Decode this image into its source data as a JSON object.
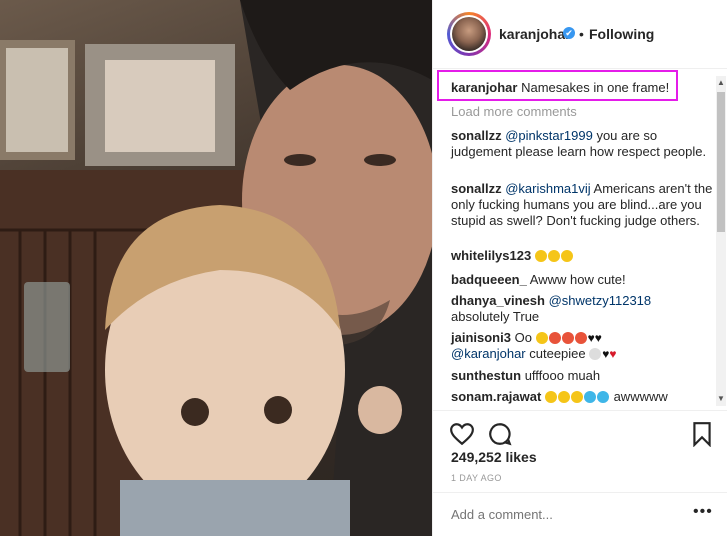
{
  "header": {
    "username": "karanjohar",
    "verified_symbol": "✔",
    "separator": "•",
    "follow_state": "Following"
  },
  "caption": {
    "username": "karanjohar",
    "text": "Namesakes in one frame!"
  },
  "load_more": "Load more comments",
  "comments": [
    {
      "user": "sonallzz",
      "mention": "@pinkstar1999",
      "text": " you are so judgement please learn how respect people."
    },
    {
      "user": "sonallzz",
      "mention": "@karishma1vij",
      "text": " Americans aren't the only fucking humans you are blind...are you stupid as swell? Don't fucking judge others."
    },
    {
      "user": "whitelilys123",
      "mention": "",
      "text": ""
    },
    {
      "user": "badqueeen_",
      "mention": "",
      "text": "Awww how cute!"
    },
    {
      "user": "dhanya_vinesh",
      "mention": "@shwetzy112318",
      "text": "absolutely True"
    },
    {
      "user": "jainisoni3",
      "mention": "@karanjohar",
      "text": "Oo",
      "text2": "cuteepiee"
    },
    {
      "user": "sunthestun",
      "mention": "",
      "text": "ufffooo muah"
    },
    {
      "user": "sonam.rajawat",
      "mention": "",
      "text": "awwwww"
    }
  ],
  "likes": "249,252 likes",
  "time_ago": "1 DAY AGO",
  "add_comment_placeholder": "Add a comment...",
  "more_label": "•••",
  "scroll": {
    "up": "▲",
    "down": "▼"
  },
  "icons": {
    "like": "heart-outline-icon",
    "comment": "speech-bubble-icon",
    "save": "bookmark-icon",
    "verified": "verified-badge-icon"
  },
  "colors": {
    "highlight": "#e41ce9",
    "verified": "#3897f0",
    "mention": "#003569"
  }
}
